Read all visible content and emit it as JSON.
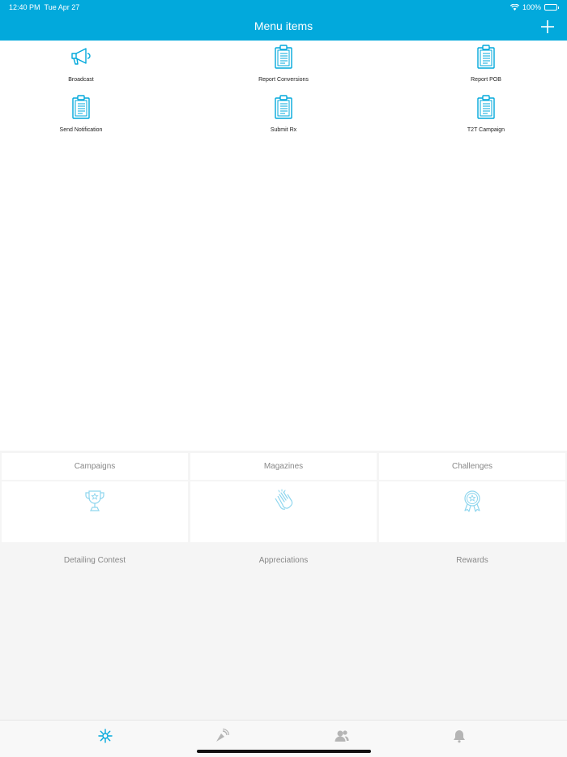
{
  "status_bar": {
    "time": "12:40 PM",
    "date": "Tue Apr 27",
    "battery": "100%",
    "wifi_icon": "wifi-icon",
    "battery_icon": "battery-icon"
  },
  "header": {
    "title": "Menu items",
    "add_icon": "plus-icon"
  },
  "menu_items": [
    {
      "label": "Broadcast",
      "icon": "megaphone-icon"
    },
    {
      "label": "Report Conversions",
      "icon": "clipboard-icon"
    },
    {
      "label": "Report POB",
      "icon": "clipboard-icon"
    },
    {
      "label": "Send Notification",
      "icon": "clipboard-icon"
    },
    {
      "label": "Submit Rx",
      "icon": "clipboard-icon"
    },
    {
      "label": "T2T Campaign",
      "icon": "clipboard-icon"
    }
  ],
  "category_tabs": [
    {
      "label": "Campaigns"
    },
    {
      "label": "Magazines"
    },
    {
      "label": "Challenges"
    }
  ],
  "feature_cards": [
    {
      "label": "Detailing Contest",
      "icon": "trophy-icon"
    },
    {
      "label": "Appreciations",
      "icon": "clapping-hands-icon"
    },
    {
      "label": "Rewards",
      "icon": "medal-icon"
    }
  ],
  "tab_bar": [
    {
      "icon": "snowflake-gear-icon",
      "active": true
    },
    {
      "icon": "broadcast-signal-icon",
      "active": false
    },
    {
      "icon": "users-icon",
      "active": false
    },
    {
      "icon": "bell-icon",
      "active": false
    }
  ],
  "colors": {
    "accent": "#02a9dc",
    "icon_light": "#8fd6ee",
    "inactive": "#b5b5b5",
    "background": "#f5f5f5"
  }
}
